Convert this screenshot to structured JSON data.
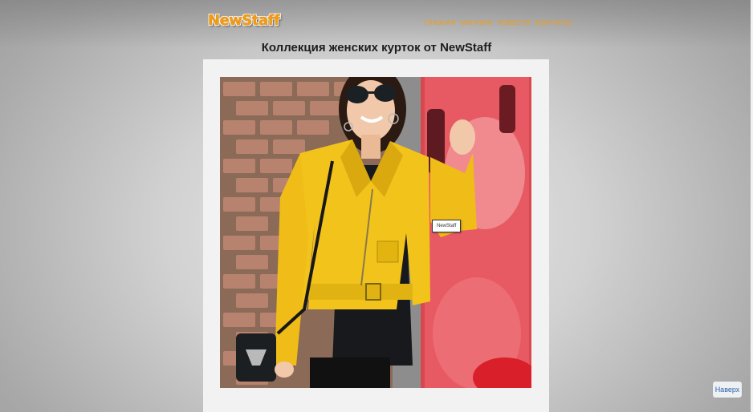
{
  "header": {
    "logo_text": "NewStaff",
    "nav": [
      "ГЛАВНАЯ",
      "МАГАЗИН",
      "НОВОСТИ",
      "КОНТАКТЫ"
    ]
  },
  "main": {
    "title": "Коллекция женских курток от NewStaff",
    "image_tag": "NewStaff"
  },
  "footer": {
    "to_top_label": "Наверх"
  },
  "colors": {
    "accent": "#f39b11",
    "jacket": "#f2c31b",
    "card": "#f2f2f2",
    "link_blue": "#2b5fa8"
  }
}
